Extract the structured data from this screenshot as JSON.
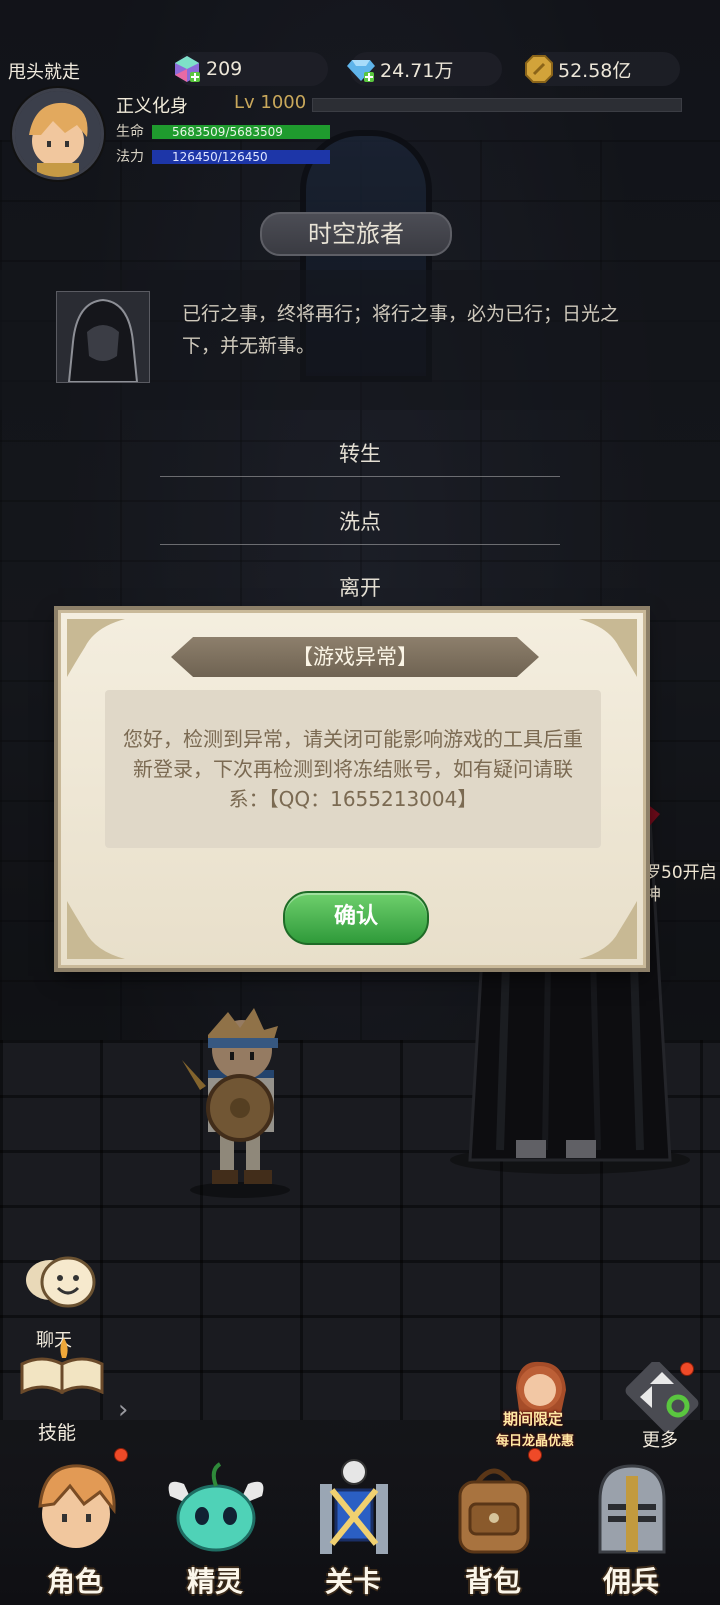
{
  "player": {
    "name": "甩头就走",
    "title": "正义化身",
    "level": "Lv 1000",
    "hp_label": "生命",
    "hp_value": "5683509/5683509",
    "mp_label": "法力",
    "mp_value": "126450/126450"
  },
  "resources": {
    "gems": "209",
    "diamonds": "24.71万",
    "gold": "52.58亿"
  },
  "npc": {
    "name": "时空旅者",
    "dialog": "已行之事，终将再行；将行之事，必为已行；日光之下，并无新事。",
    "options": [
      "转生",
      "洗点",
      "离开"
    ]
  },
  "modal": {
    "title": "【游戏异常】",
    "message": "您好，检测到异常，请关闭可能影响游戏的工具后重新登录，下次再检测到将冻结账号，如有疑问请联系：【QQ：1655213004】",
    "confirm_label": "确认"
  },
  "side": {
    "line1": "罗50开启",
    "line2": "神"
  },
  "controls": {
    "chat_label": "聊天",
    "skill_label": "技能",
    "promo_line1": "期间限定",
    "promo_line2": "每日龙晶优惠",
    "more_label": "更多"
  },
  "nav": [
    {
      "label": "角色",
      "icon": "hero-portrait-icon"
    },
    {
      "label": "精灵",
      "icon": "spirit-slime-icon"
    },
    {
      "label": "关卡",
      "icon": "crossed-swords-icon"
    },
    {
      "label": "背包",
      "icon": "backpack-icon"
    },
    {
      "label": "佣兵",
      "icon": "knight-helmet-icon"
    }
  ],
  "colors": {
    "hp": "#1f9b2e",
    "mp": "#1d36a8",
    "confirm": "#2f9a3a",
    "level": "#c9a85b",
    "badge": "#ef4a28"
  }
}
